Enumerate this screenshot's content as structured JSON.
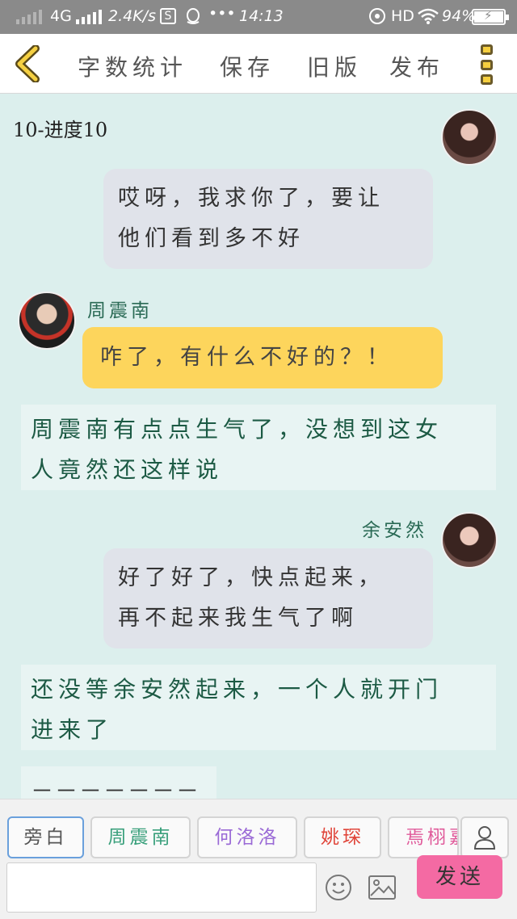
{
  "status_bar": {
    "network": "4G",
    "speed": "2.4K/s",
    "s_badge": "S",
    "dots": "•••",
    "time": "14:13",
    "hd": "HD",
    "battery": "94%",
    "battery_level": 0.94
  },
  "header": {
    "word_count": "字数统计",
    "save": "保存",
    "old_version": "旧版",
    "publish": "发布"
  },
  "chat": {
    "chapter_title": "10-进度10",
    "bubble1": [
      "哎呀，我求你了，要让",
      "他们看到多不好"
    ],
    "name_zhou": "周震南",
    "bubble2": "咋了，有什么不好的？！",
    "narration1": [
      "周震南有点点生气了，没想到这女",
      "人竟然还这样说"
    ],
    "name_yu": "余安然",
    "bubble3": [
      "好了好了，快点起来，",
      "再不起来我生气了啊"
    ],
    "narration2": [
      "还没等余安然起来，一个人就开门",
      "进来了"
    ],
    "narration3": "－－－－－－－"
  },
  "bottom": {
    "roles": [
      {
        "label": "旁白",
        "color": "#555555"
      },
      {
        "label": "周震南",
        "color": "#3aa07c"
      },
      {
        "label": "何洛洛",
        "color": "#9a6ad6"
      },
      {
        "label": "姚琛",
        "color": "#e0453a"
      },
      {
        "label": "焉栩嘉",
        "color": "#e05a9a"
      }
    ],
    "send": "发送"
  },
  "colors": {
    "background": "#dcefed",
    "yellow_bubble": "#fdd55c",
    "gray_bubble": "#e0e3ea",
    "send_button": "#f46aa3"
  }
}
